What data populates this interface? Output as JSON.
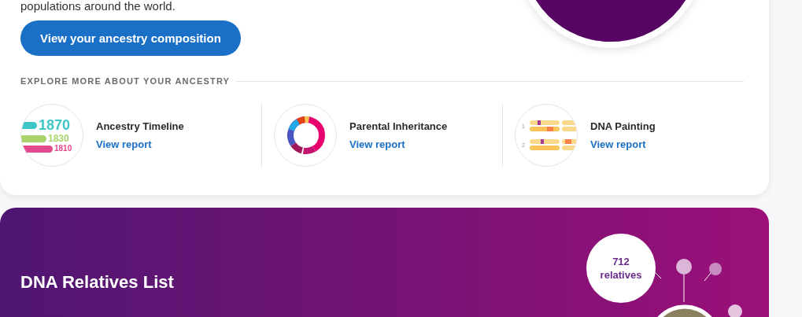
{
  "intro": {
    "text": "populations around the world."
  },
  "cta": {
    "label": "View your ancestry composition"
  },
  "explore": {
    "heading": "EXPLORE MORE ABOUT YOUR ANCESTRY",
    "items": [
      {
        "kind": "timeline",
        "title": "Ancestry Timeline",
        "link": "View report",
        "years": [
          "1870",
          "1830",
          "1810"
        ]
      },
      {
        "kind": "inheritance",
        "title": "Parental Inheritance",
        "link": "View report"
      },
      {
        "kind": "painting",
        "title": "DNA Painting",
        "link": "View report",
        "rows": [
          "1",
          "2"
        ]
      }
    ]
  },
  "relatives": {
    "title": "DNA Relatives List",
    "count": "712",
    "unit": "relatives"
  }
}
